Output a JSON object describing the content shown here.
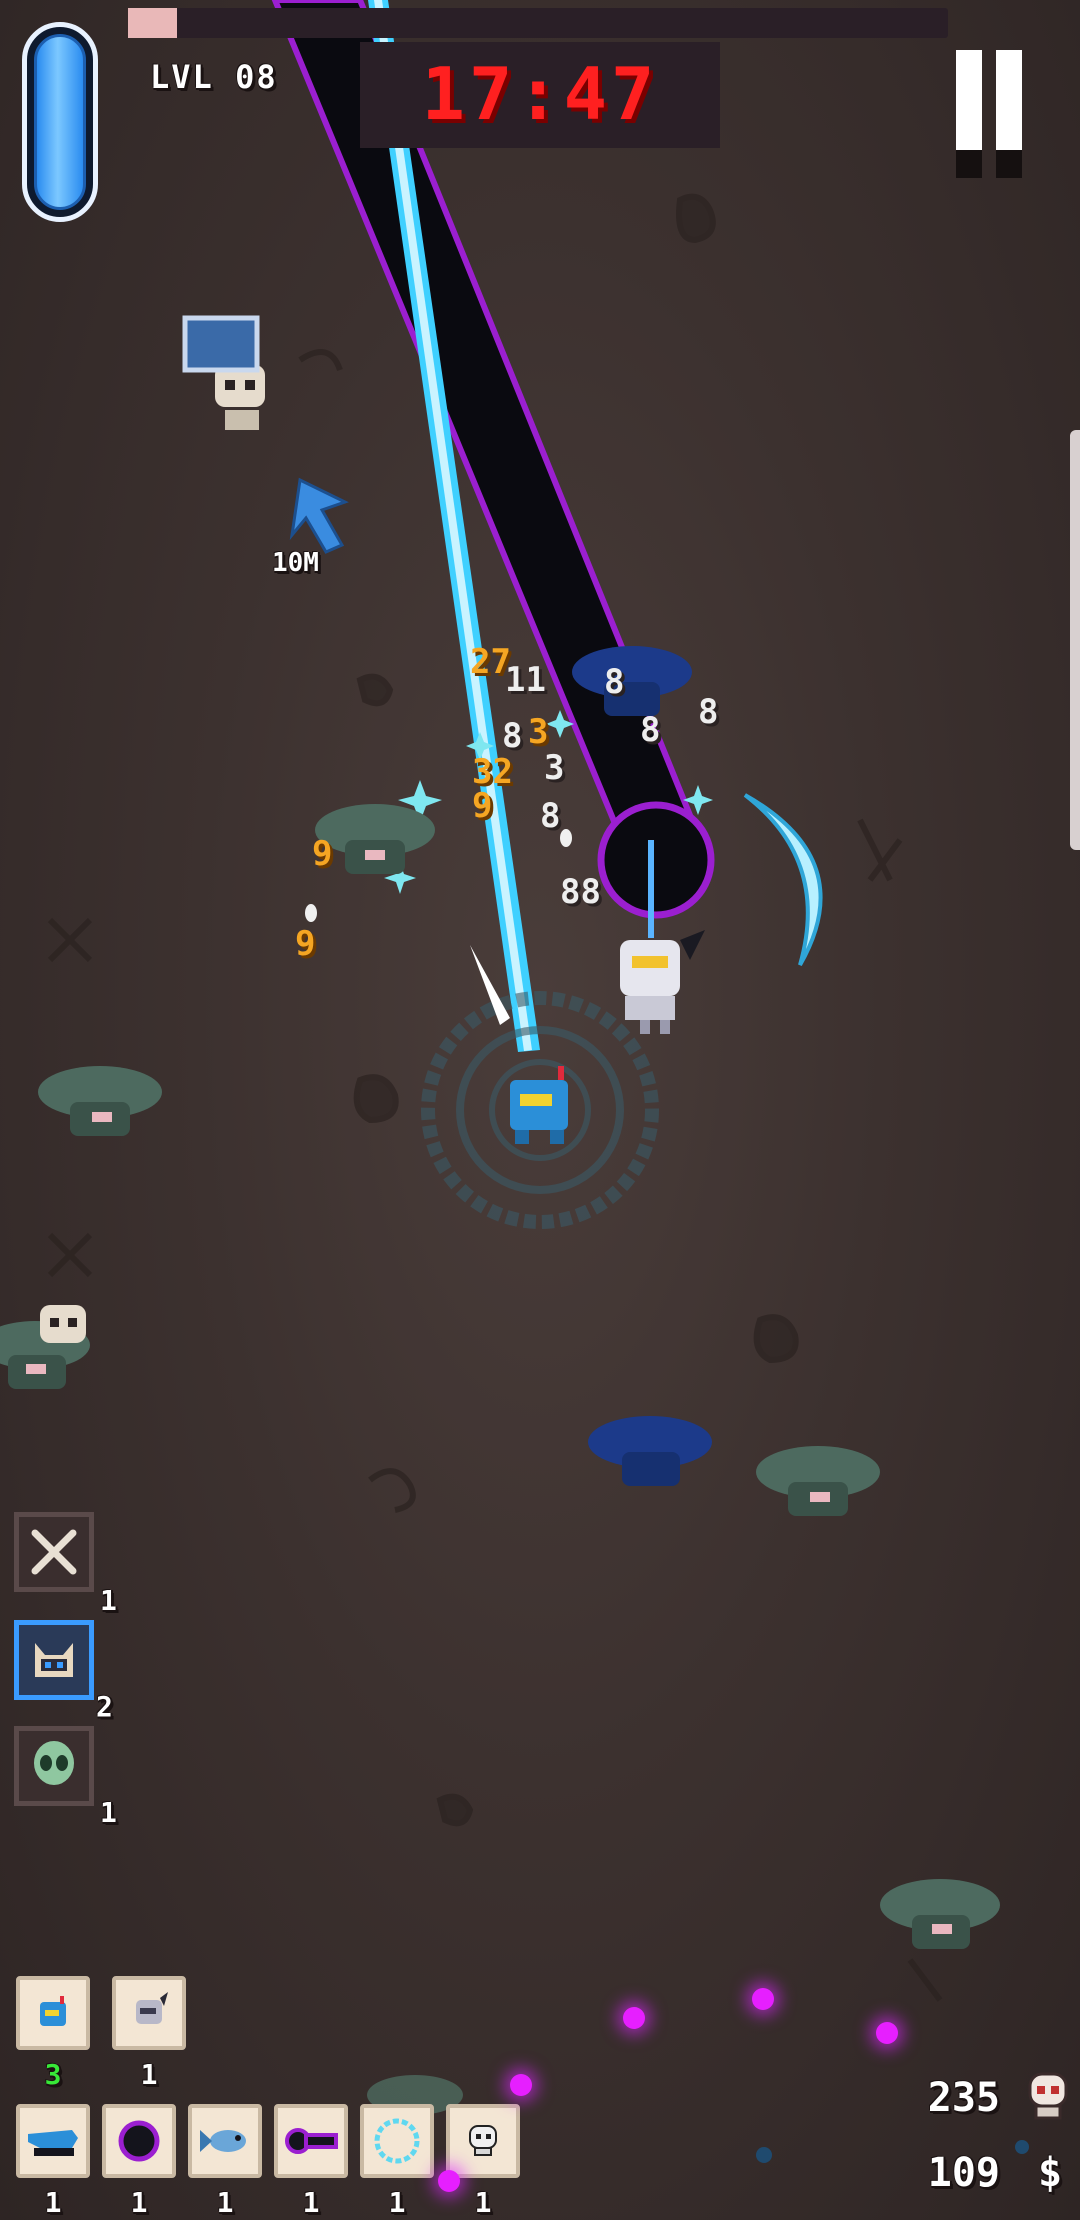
{
  "hud": {
    "level_text": "LVL 08",
    "timer_text": "17:47",
    "xp_fraction": 0.06,
    "health_fraction": 1.0,
    "pause_icon": "pause-icon"
  },
  "world": {
    "marker_distance": "10M",
    "damage_numbers": [
      {
        "text": "27",
        "color": "orange"
      },
      {
        "text": "11",
        "color": "white"
      },
      {
        "text": "8",
        "color": "white"
      },
      {
        "text": "8",
        "color": "white"
      },
      {
        "text": "8",
        "color": "white"
      },
      {
        "text": "8",
        "color": "white"
      },
      {
        "text": "3",
        "color": "orange"
      },
      {
        "text": "32",
        "color": "orange"
      },
      {
        "text": "3",
        "color": "white"
      },
      {
        "text": "9",
        "color": "orange"
      },
      {
        "text": "8",
        "color": "white"
      },
      {
        "text": "88",
        "color": "white"
      },
      {
        "text": "9",
        "color": "orange"
      },
      {
        "text": "9",
        "color": "orange"
      }
    ]
  },
  "abilities": [
    {
      "icon": "crossed-bones-icon",
      "count": "1",
      "active": false
    },
    {
      "icon": "cat-companion-icon",
      "count": "2",
      "active": true
    },
    {
      "icon": "alien-head-icon",
      "count": "1",
      "active": false
    }
  ],
  "companions": [
    {
      "icon": "blue-hero-icon",
      "count": "3"
    },
    {
      "icon": "robot-knight-icon",
      "count": "1"
    }
  ],
  "weapons": [
    {
      "icon": "laser-gun-icon",
      "count": "1"
    },
    {
      "icon": "black-hole-icon",
      "count": "1"
    },
    {
      "icon": "fish-missile-icon",
      "count": "1"
    },
    {
      "icon": "purple-beam-icon",
      "count": "1"
    },
    {
      "icon": "cyan-ring-icon",
      "count": "1"
    },
    {
      "icon": "skull-icon",
      "count": "1"
    }
  ],
  "stats": {
    "kills": "235",
    "kills_icon": "skull-icon",
    "money": "109",
    "money_symbol": "$"
  },
  "colors": {
    "background": "#3c312f",
    "timer": "#ff2020",
    "health": "#2a8cf0",
    "beam_cyan": "#3fd0ff",
    "beam_purple": "#9b1fd0",
    "damage_orange": "#f5a623",
    "orb_magenta": "#e61fff"
  }
}
